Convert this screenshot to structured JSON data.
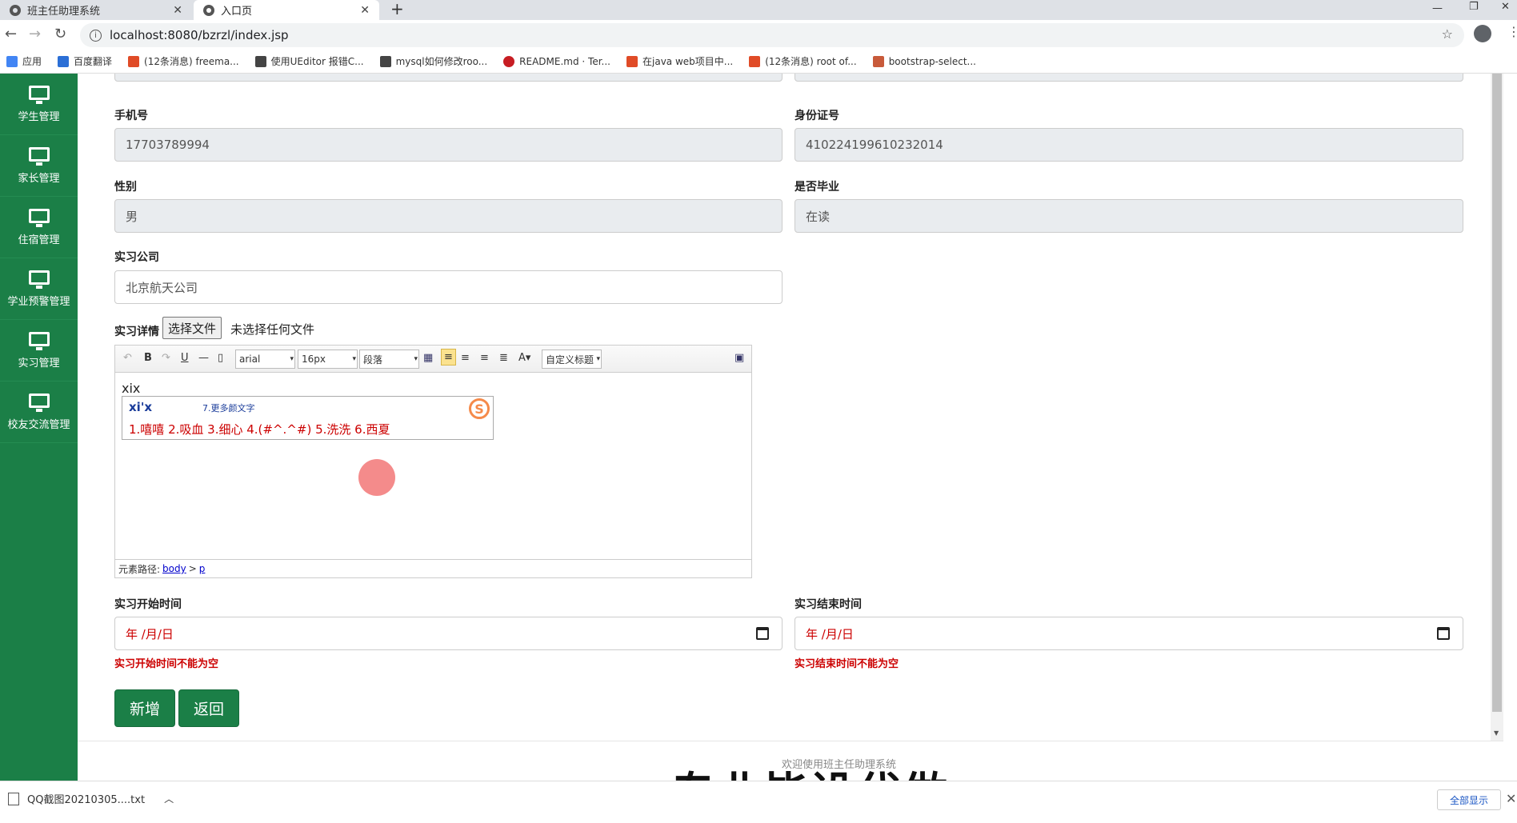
{
  "browser": {
    "tabs": [
      {
        "title": "班主任助理系统",
        "active": false
      },
      {
        "title": "入口页",
        "active": true
      }
    ],
    "url": "localhost:8080/bzrzl/index.jsp",
    "bookmarks": [
      "应用",
      "百度翻译",
      "(12条消息) freema...",
      "使用UEditor 报错C...",
      "mysql如何修改roo...",
      "README.md · Ter...",
      "在java web项目中...",
      "(12条消息) root of...",
      "bootstrap-select..."
    ]
  },
  "sidebar": {
    "items": [
      {
        "label": "学生管理",
        "icon": "monitor-icon"
      },
      {
        "label": "家长管理",
        "icon": "monitor-icon"
      },
      {
        "label": "住宿管理",
        "icon": "monitor-icon"
      },
      {
        "label": "学业预警管理",
        "icon": "monitor-icon"
      },
      {
        "label": "实习管理",
        "icon": "monitor-icon"
      },
      {
        "label": "校友交流管理",
        "icon": "monitor-icon"
      }
    ]
  },
  "form": {
    "phone_label": "手机号",
    "phone_value": "17703789994",
    "idcard_label": "身份证号",
    "idcard_value": "410224199610232014",
    "gender_label": "性别",
    "gender_value": "男",
    "graduated_label": "是否毕业",
    "graduated_value": "在读",
    "company_label": "实习公司",
    "company_value": "北京航天公司",
    "detail_label": "实习详情",
    "file_button": "选择文件",
    "file_status": "未选择任何文件",
    "start_label": "实习开始时间",
    "start_value": "年 /月/日",
    "start_error": "实习开始时间不能为空",
    "end_label": "实习结束时间",
    "end_value": "年 /月/日",
    "end_error": "实习结束时间不能为空",
    "add_button": "新增",
    "back_button": "返回"
  },
  "editor": {
    "font": "arial",
    "size": "16px",
    "paragraph": "段落",
    "custom_title": "自定义标题",
    "content": "xix",
    "ime_composition": "xi'x",
    "ime_hint": "7.更多颜文字",
    "ime_candidates": "1.嘻嘻  2.吸血  3.细心  4.(#^.^#)  5.洗洗  6.西夏",
    "path_label": "元素路径:",
    "path_body": "body",
    "path_sep": ">",
    "path_p": "p"
  },
  "footer": {
    "text": "欢迎使用班主任助理系统",
    "watermark": "专业毕设代做"
  },
  "downloads": {
    "file": "QQ截图20210305....txt",
    "show_all": "全部显示"
  }
}
